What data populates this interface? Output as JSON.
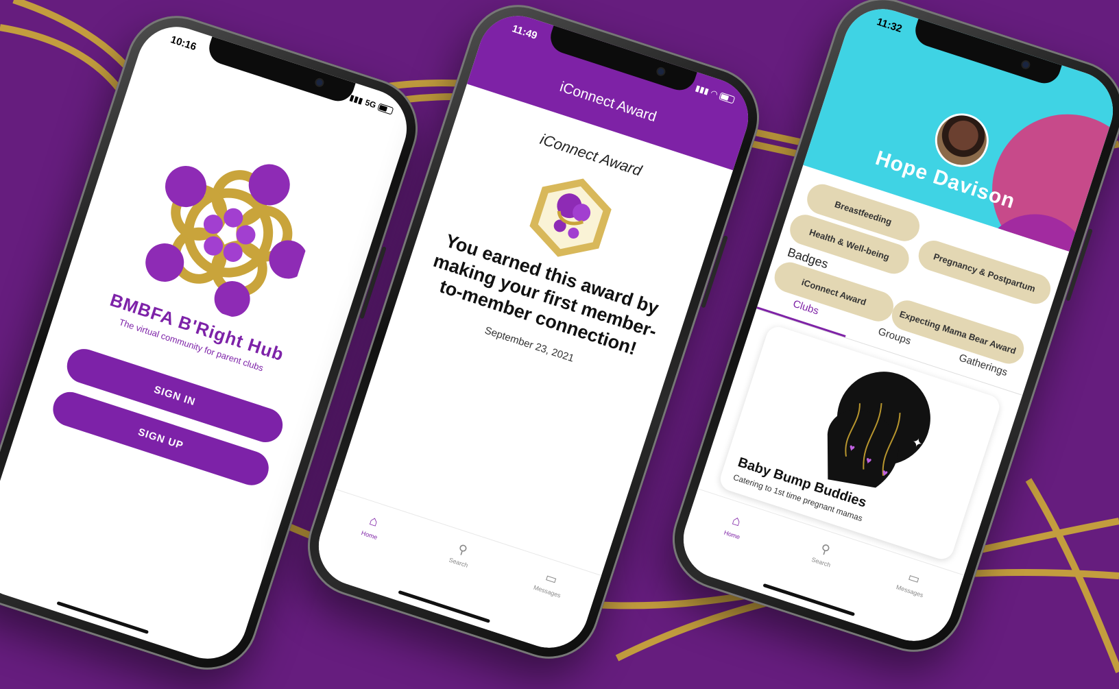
{
  "phones": [
    {
      "status": {
        "time": "10:16",
        "network": "5G"
      },
      "brand": {
        "title": "BMBFA B'Right Hub",
        "subtitle": "The virtual community for parent clubs"
      },
      "buttons": {
        "sign_in": "SIGN IN",
        "sign_up": "SIGN UP"
      }
    },
    {
      "status": {
        "time": "11:49"
      },
      "appbar_title": "iConnect Award",
      "award": {
        "title": "iConnect Award",
        "message": "You earned this award by making your first member-to-member connection!",
        "date": "September 23, 2021"
      },
      "tabs": [
        {
          "label": "Home",
          "icon": "home-icon",
          "active": true
        },
        {
          "label": "Search",
          "icon": "search-icon",
          "active": false
        },
        {
          "label": "Messages",
          "icon": "chat-icon",
          "active": false
        }
      ]
    },
    {
      "status": {
        "time": "11:32"
      },
      "profile": {
        "name": "Hope Davison"
      },
      "interests": [
        "Breastfeeding",
        "Pregnancy & Postpartum",
        "Health & Well-being"
      ],
      "badges_label": "Badges",
      "badges": [
        "iConnect Award",
        "Expecting Mama Bear Award"
      ],
      "section_tabs": [
        {
          "label": "Clubs",
          "active": true
        },
        {
          "label": "Groups",
          "active": false
        },
        {
          "label": "Gatherings",
          "active": false
        }
      ],
      "club": {
        "name": "Baby Bump Buddies",
        "description": "Catering to 1st time pregnant mamas"
      },
      "tabs": [
        {
          "label": "Home",
          "icon": "home-icon",
          "active": true
        },
        {
          "label": "Search",
          "icon": "search-icon",
          "active": false
        },
        {
          "label": "Messages",
          "icon": "chat-icon",
          "active": false
        }
      ]
    }
  ],
  "colors": {
    "background": "#661d7e",
    "brand_purple": "#7e22a6",
    "gold": "#c9a43b",
    "chip": "#e3d7b3",
    "hero": "#3fd3e4"
  }
}
